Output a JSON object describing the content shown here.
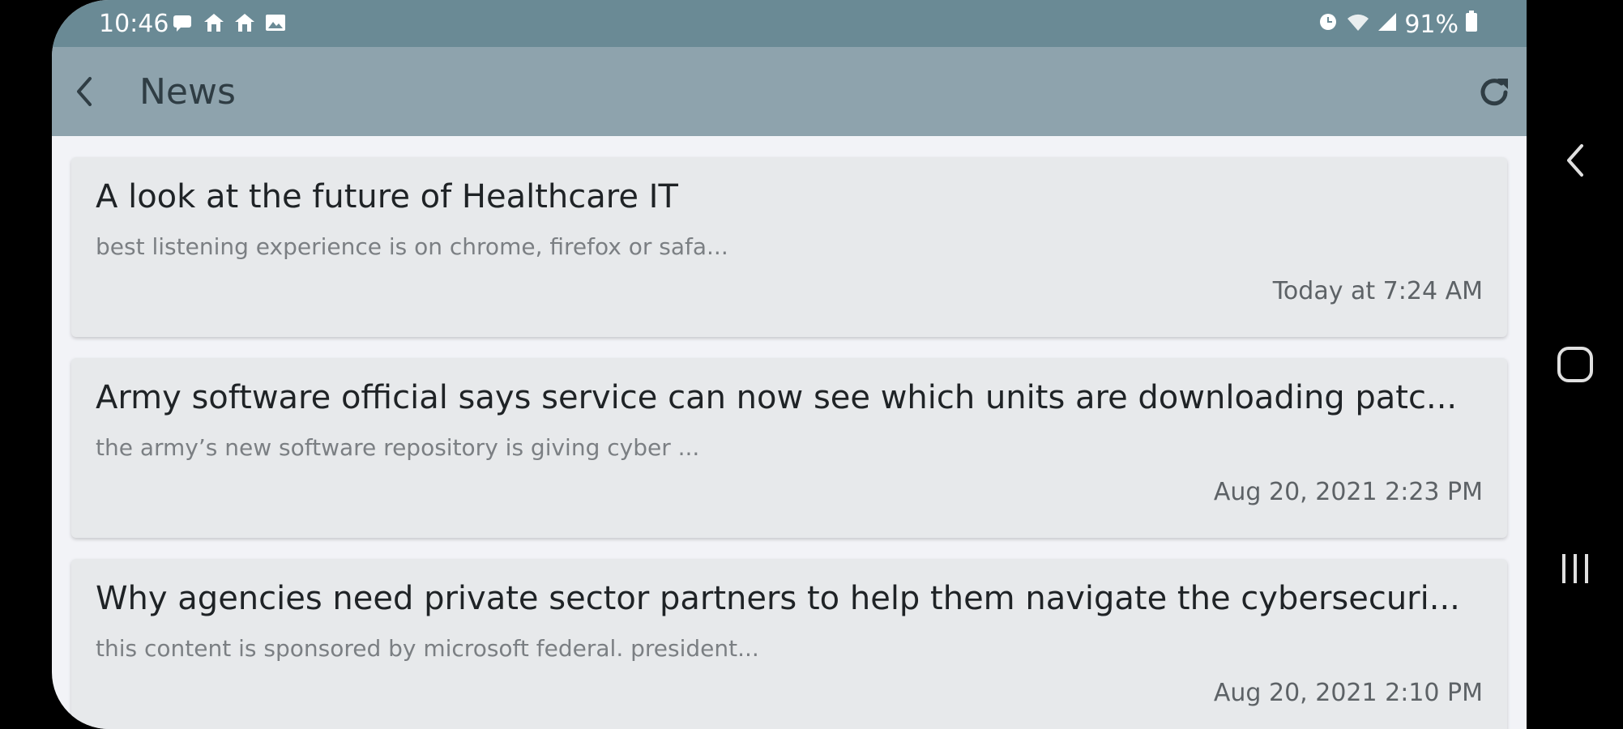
{
  "status_bar": {
    "time": "10:46",
    "battery": "91%",
    "left_icons": [
      "message-icon",
      "home-icon",
      "home-icon",
      "image-icon"
    ],
    "right_icons": [
      "alarm-icon",
      "wifi-icon",
      "signal-icon",
      "battery-icon"
    ]
  },
  "app_bar": {
    "title": "News",
    "back_icon": "chevron-left-icon",
    "refresh_icon": "refresh-icon"
  },
  "articles": [
    {
      "title": "A look at the future of Healthcare IT",
      "snippet": " best listening experience is on chrome, firefox or safa...",
      "date": "Today at 7:24 AM"
    },
    {
      "title": "Army software official says service can now see which units are downloading patc...",
      "snippet": "the army’s new software repository is giving cyber ...",
      "date": "Aug 20, 2021 2:23 PM"
    },
    {
      "title": "Why agencies need private sector partners to help them navigate the cybersecuri...",
      "snippet": "this content is sponsored by microsoft federal. president...",
      "date": "Aug 20, 2021 2:10 PM"
    }
  ],
  "colors": {
    "status_bar": "#6a8a95",
    "app_bar": "#8ea3ad",
    "card": "#e7e9eb",
    "background": "#f2f3f7"
  },
  "nav": {
    "back_icon": "nav-back-icon",
    "home_icon": "nav-home-icon",
    "recents_icon": "nav-recents-icon"
  }
}
